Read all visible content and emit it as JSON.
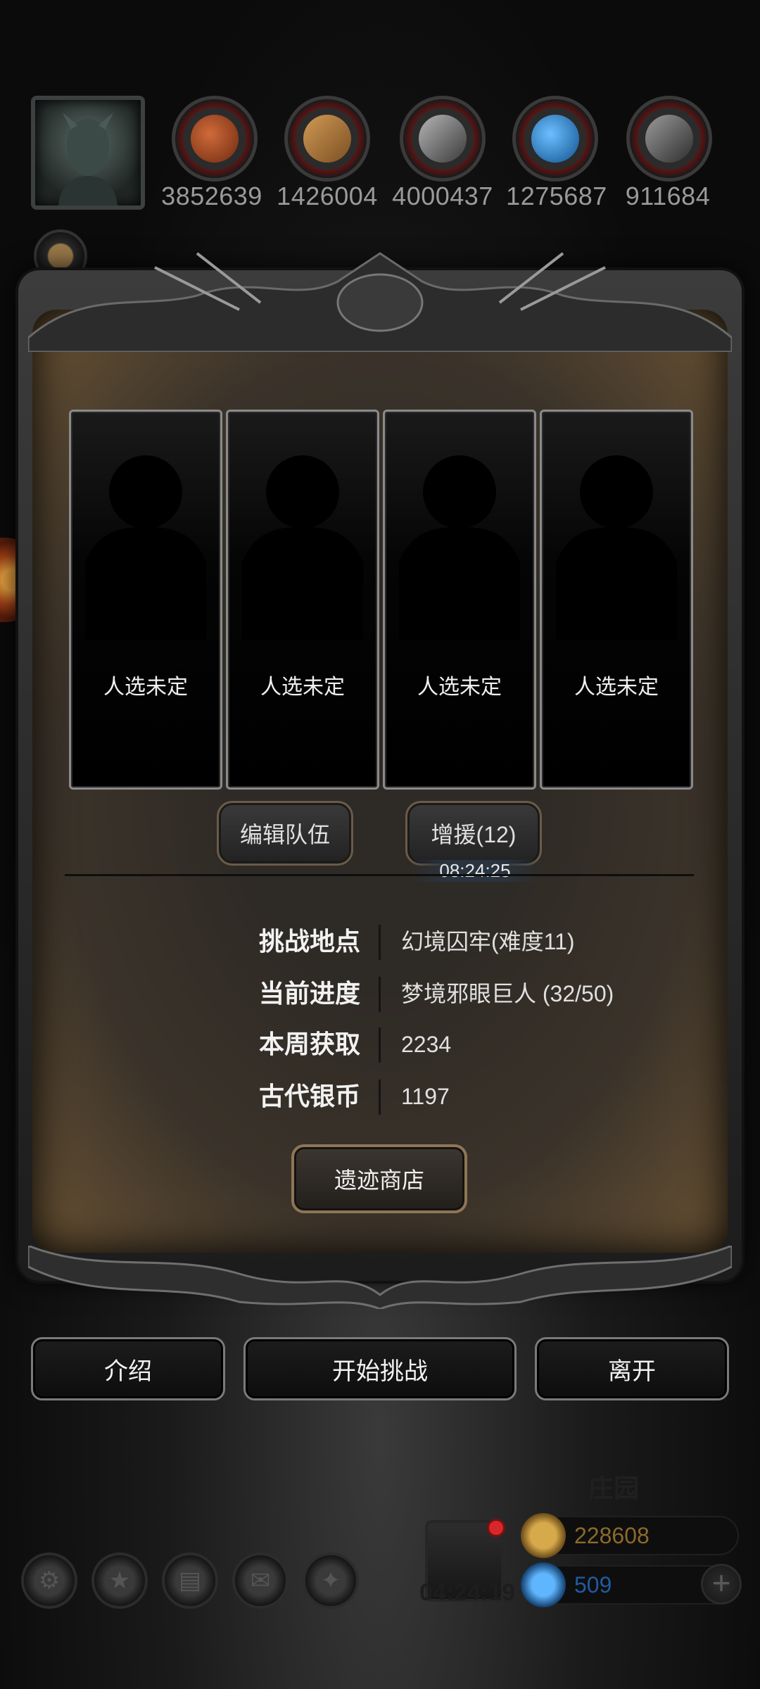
{
  "resources": [
    {
      "name": "meat-icon",
      "value": "3852639",
      "color": "#b5522a"
    },
    {
      "name": "wood-icon",
      "value": "1426004",
      "color": "#b07a3c"
    },
    {
      "name": "stone-icon",
      "value": "4000437",
      "color": "#8a8a8a"
    },
    {
      "name": "crystal-icon",
      "value": "1275687",
      "color": "#2f8de0"
    },
    {
      "name": "iron-icon",
      "value": "911684",
      "color": "#7a7a7a"
    }
  ],
  "team_slots": [
    {
      "label": "人选未定"
    },
    {
      "label": "人选未定"
    },
    {
      "label": "人选未定"
    },
    {
      "label": "人选未定"
    }
  ],
  "team": {
    "edit_label": "编辑队伍",
    "reinforce_label": "增援(12)",
    "reinforce_timer": "08:24:25"
  },
  "info": [
    {
      "key": "挑战地点",
      "value": "幻境囚牢(难度11)"
    },
    {
      "key": "当前进度",
      "value": "梦境邪眼巨人 (32/50)"
    },
    {
      "key": "本周获取",
      "value": "2234"
    },
    {
      "key": "古代银币",
      "value": "1197"
    }
  ],
  "shop_label": "遗迹商店",
  "actions": {
    "intro": "介绍",
    "start": "开始挑战",
    "leave": "离开"
  },
  "background": {
    "estate_label": "庄园"
  },
  "bottom": {
    "gift_timer": "04:24:19",
    "gold": "228608",
    "gems": "509",
    "gold_color": "#8a6a2a",
    "gem_color": "#1f5aa0"
  }
}
